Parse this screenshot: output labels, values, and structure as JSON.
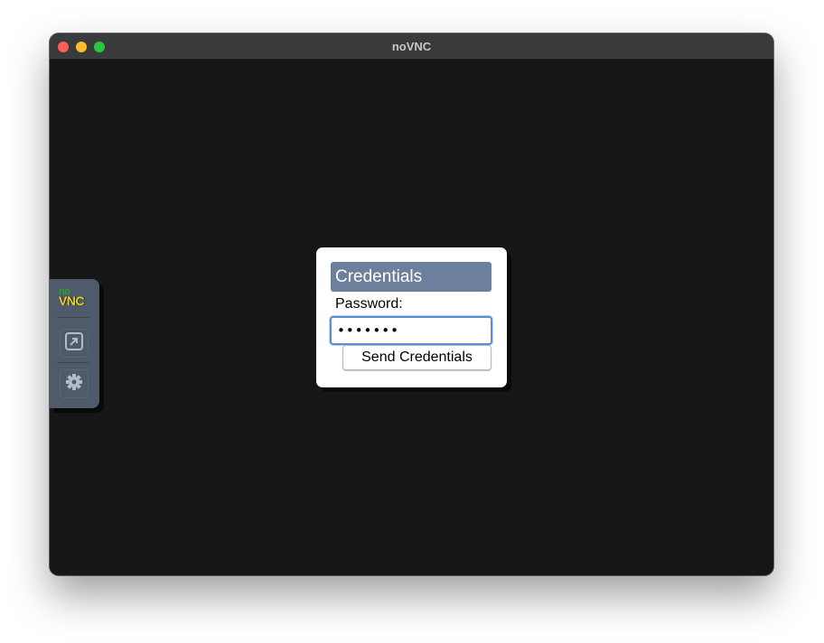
{
  "window": {
    "title": "noVNC",
    "controls": {
      "close_color": "#fe5f57",
      "minimize_color": "#febc2e",
      "zoom_color": "#28c840"
    }
  },
  "control_bar": {
    "logo_no": "no",
    "logo_vnc": "VNC",
    "buttons": [
      {
        "name": "fullscreen",
        "icon": "fullscreen-icon"
      },
      {
        "name": "settings",
        "icon": "gear-icon"
      }
    ]
  },
  "dialog": {
    "title": "Credentials",
    "password_label": "Password:",
    "password_value": "1234567",
    "send_label": "Send Credentials"
  }
}
